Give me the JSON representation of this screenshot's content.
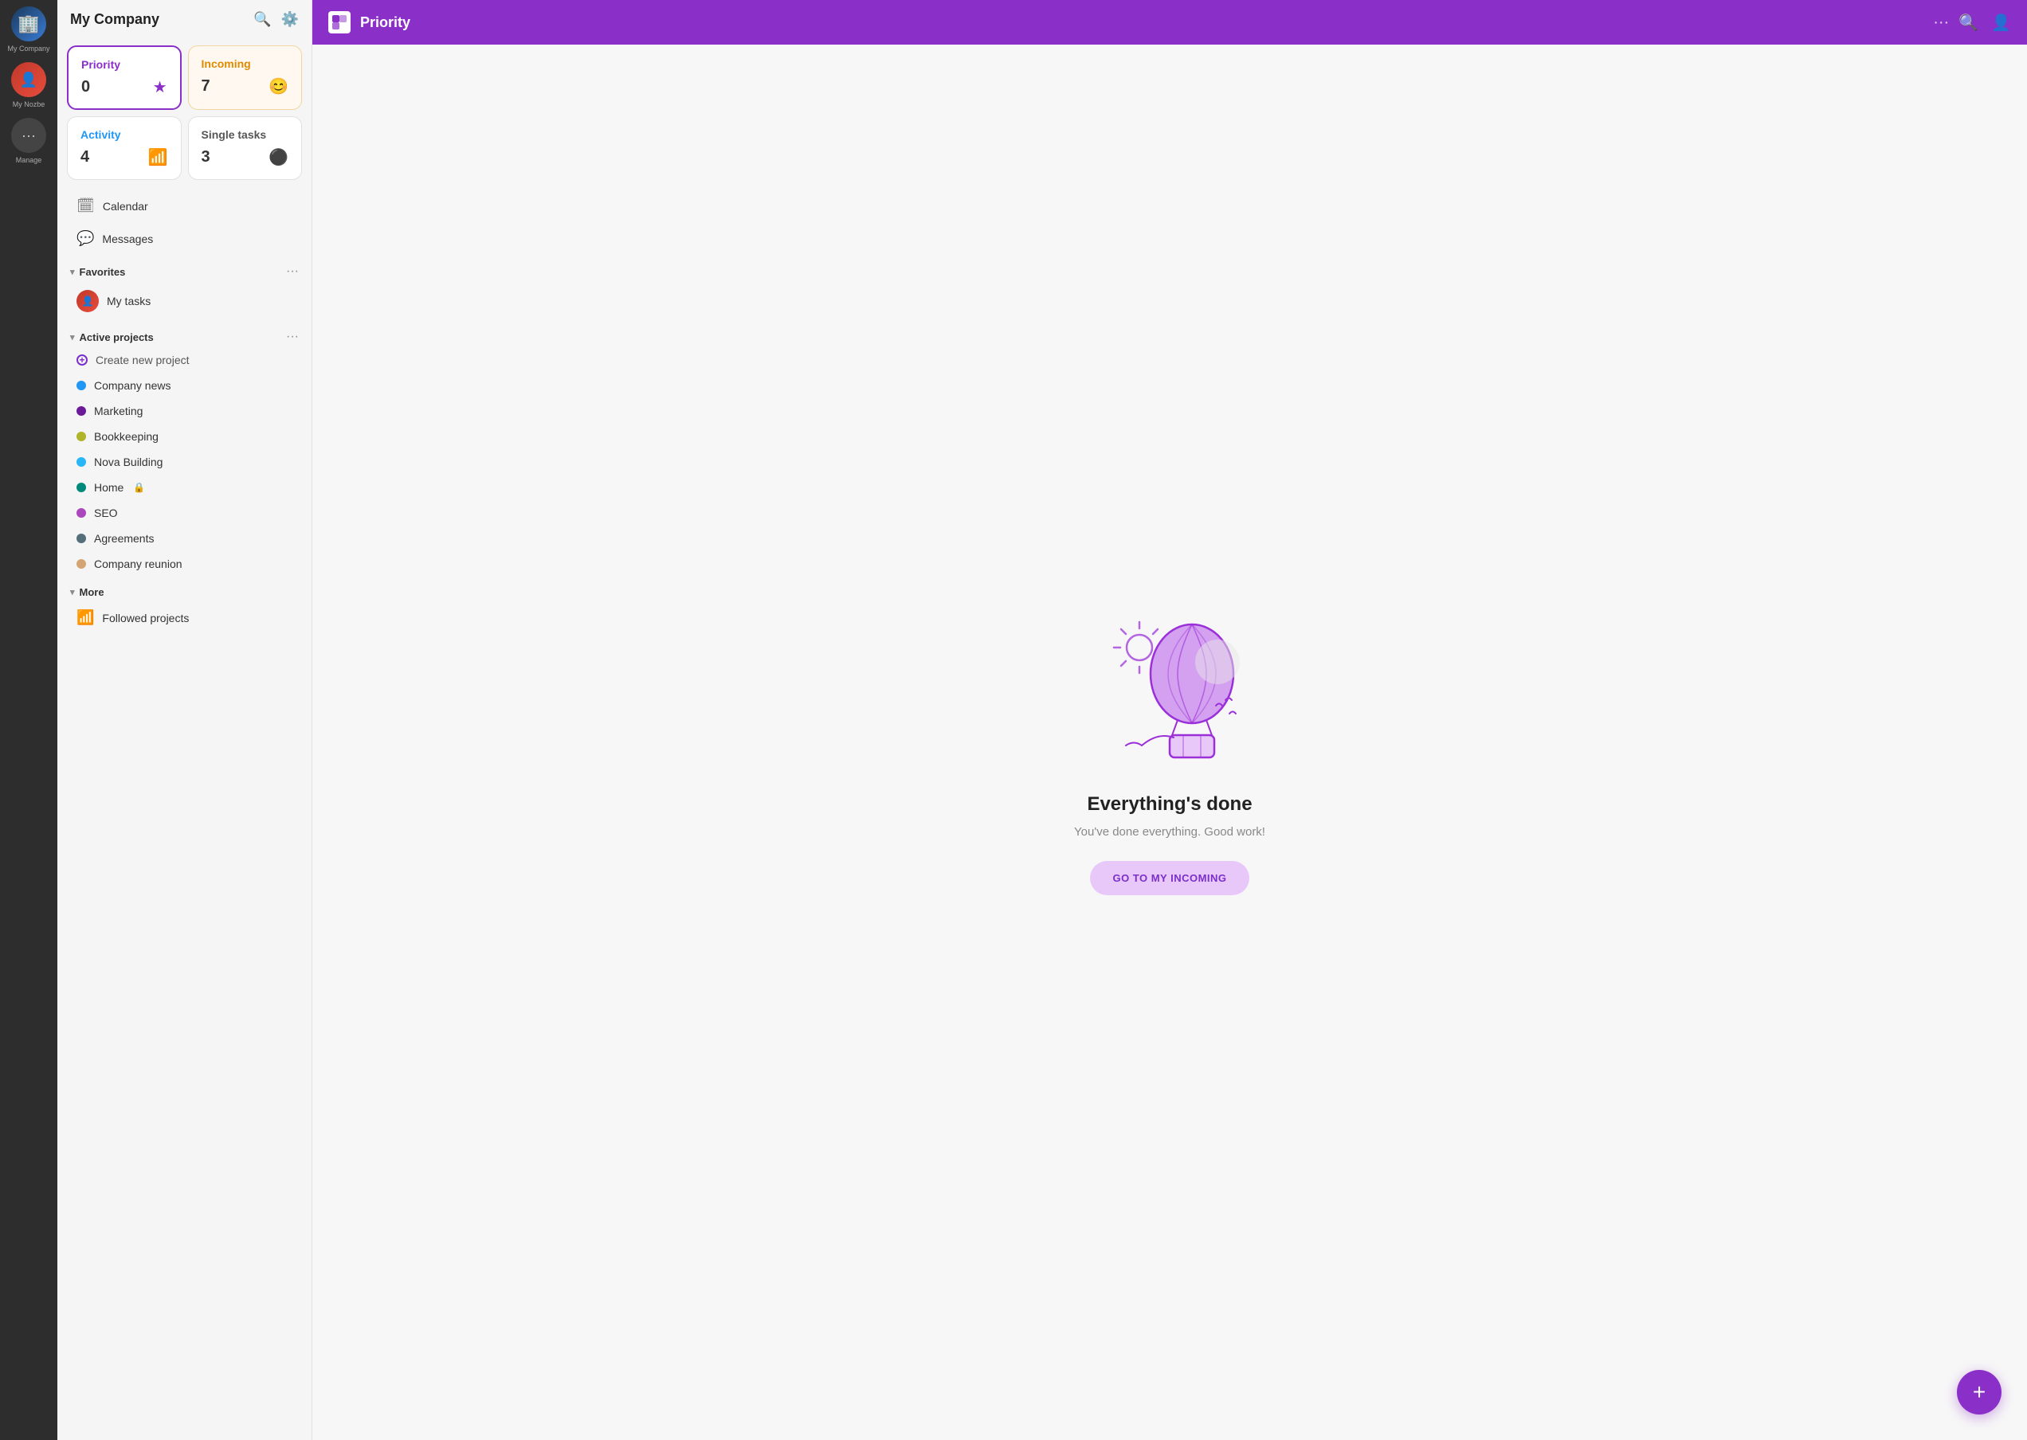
{
  "app": {
    "company_name": "My Company",
    "user_label": "My Nozbe",
    "manage_label": "Manage"
  },
  "topbar": {
    "logo_text": "N",
    "title": "Priority",
    "dots_label": "···"
  },
  "cards": [
    {
      "id": "priority",
      "title": "Priority",
      "count": "0",
      "icon": "★",
      "style": "priority"
    },
    {
      "id": "incoming",
      "title": "Incoming",
      "count": "7",
      "icon": "😊",
      "style": "incoming"
    },
    {
      "id": "activity",
      "title": "Activity",
      "count": "4",
      "icon": "📶",
      "style": "activity"
    },
    {
      "id": "single-tasks",
      "title": "Single tasks",
      "count": "3",
      "icon": "⚫",
      "style": "single-tasks"
    }
  ],
  "nav": {
    "calendar_label": "Calendar",
    "messages_label": "Messages"
  },
  "favorites": {
    "section_label": "Favorites",
    "items": [
      {
        "label": "My tasks",
        "has_avatar": true
      }
    ]
  },
  "active_projects": {
    "section_label": "Active projects",
    "create_label": "Create new project",
    "projects": [
      {
        "label": "Company news",
        "color": "#2196f3"
      },
      {
        "label": "Marketing",
        "color": "#6a1b9a"
      },
      {
        "label": "Bookkeeping",
        "color": "#afb42b"
      },
      {
        "label": "Nova Building",
        "color": "#29b6f6"
      },
      {
        "label": "Home",
        "color": "#00897b",
        "locked": true
      },
      {
        "label": "SEO",
        "color": "#ab47bc"
      },
      {
        "label": "Agreements",
        "color": "#546e7a"
      },
      {
        "label": "Company reunion",
        "color": "#d4a574"
      }
    ]
  },
  "more": {
    "section_label": "More"
  },
  "followed_projects": {
    "section_label": "Followed projects"
  },
  "central": {
    "title": "Everything's done",
    "subtitle": "You've done everything. Good work!",
    "cta_label": "GO TO MY INCOMING"
  },
  "fab": {
    "label": "+"
  }
}
